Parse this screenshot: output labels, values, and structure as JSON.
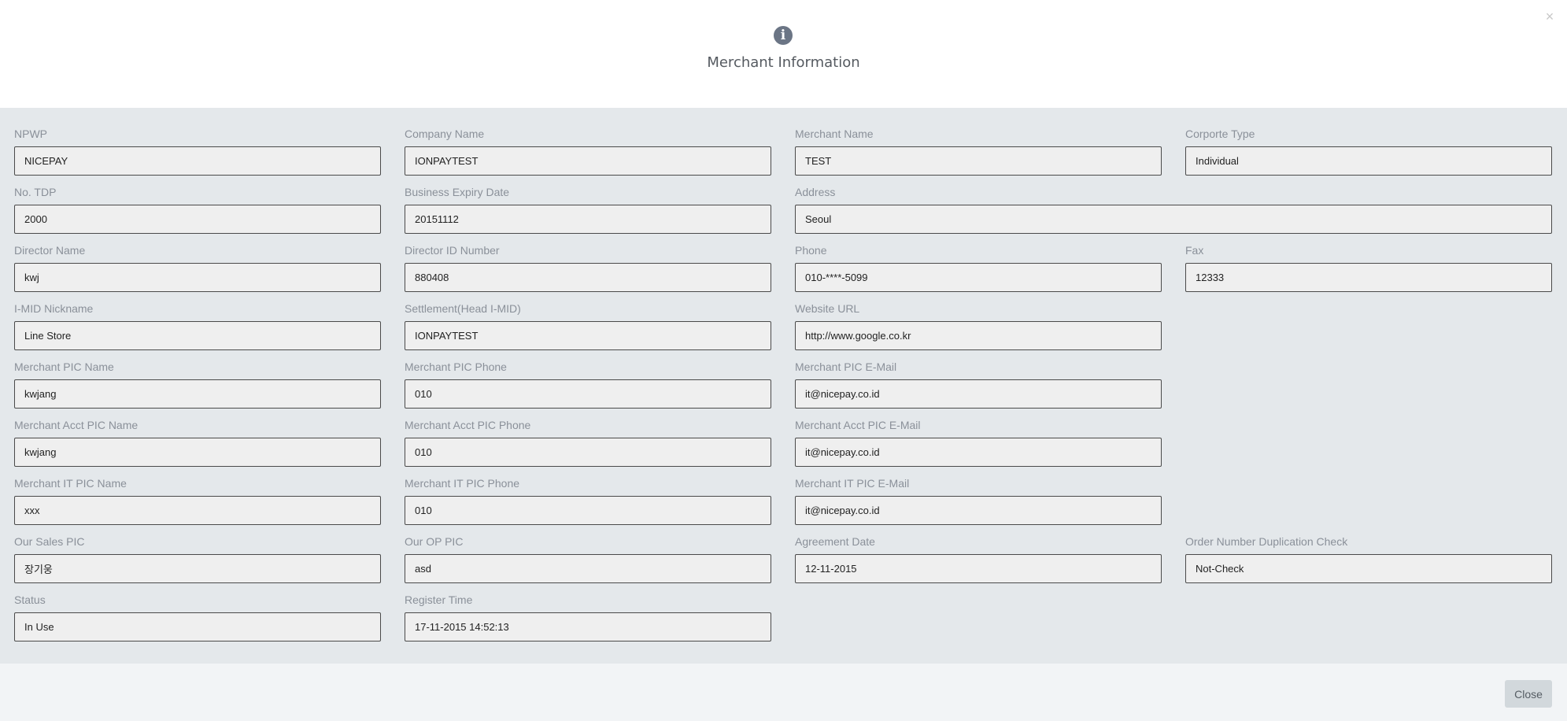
{
  "header": {
    "icon": "info-circle-icon",
    "title": "Merchant Information",
    "close_icon": "×"
  },
  "fields": {
    "npwp": {
      "label": "NPWP",
      "value": "NICEPAY"
    },
    "company_name": {
      "label": "Company Name",
      "value": "IONPAYTEST"
    },
    "merchant_name": {
      "label": "Merchant Name",
      "value": "TEST"
    },
    "corporate_type": {
      "label": "Corporte Type",
      "value": "Individual"
    },
    "no_tdp": {
      "label": "No. TDP",
      "value": "2000"
    },
    "business_expiry_date": {
      "label": "Business Expiry Date",
      "value": "20151112"
    },
    "address": {
      "label": "Address",
      "value": "Seoul"
    },
    "director_name": {
      "label": "Director Name",
      "value": "kwj"
    },
    "director_id_number": {
      "label": "Director ID Number",
      "value": "880408"
    },
    "phone": {
      "label": "Phone",
      "value": "010-****-5099"
    },
    "fax": {
      "label": "Fax",
      "value": "12333"
    },
    "imid_nickname": {
      "label": "I-MID Nickname",
      "value": "Line Store"
    },
    "settlement_head_imid": {
      "label": "Settlement(Head I-MID)",
      "value": "IONPAYTEST"
    },
    "website_url": {
      "label": "Website URL",
      "value": "http://www.google.co.kr"
    },
    "merchant_pic_name": {
      "label": "Merchant PIC Name",
      "value": "kwjang"
    },
    "merchant_pic_phone": {
      "label": "Merchant PIC Phone",
      "value": "010"
    },
    "merchant_pic_email": {
      "label": "Merchant PIC E-Mail",
      "value": "it@nicepay.co.id"
    },
    "merchant_acct_pic_name": {
      "label": "Merchant Acct PIC Name",
      "value": "kwjang"
    },
    "merchant_acct_pic_phone": {
      "label": "Merchant Acct PIC Phone",
      "value": "010"
    },
    "merchant_acct_pic_email": {
      "label": "Merchant Acct PIC E-Mail",
      "value": "it@nicepay.co.id"
    },
    "merchant_it_pic_name": {
      "label": "Merchant IT PIC Name",
      "value": "xxx"
    },
    "merchant_it_pic_phone": {
      "label": "Merchant IT PIC Phone",
      "value": "010"
    },
    "merchant_it_pic_email": {
      "label": "Merchant IT PIC E-Mail",
      "value": "it@nicepay.co.id"
    },
    "our_sales_pic": {
      "label": "Our Sales PIC",
      "value": "장기웅"
    },
    "our_op_pic": {
      "label": "Our OP PIC",
      "value": "asd"
    },
    "agreement_date": {
      "label": "Agreement Date",
      "value": "12-11-2015"
    },
    "order_number_duplication_check": {
      "label": "Order Number Duplication Check",
      "value": "Not-Check"
    },
    "status": {
      "label": "Status",
      "value": "In Use"
    },
    "register_time": {
      "label": "Register Time",
      "value": "17-11-2015 14:52:13"
    }
  },
  "footer": {
    "close_label": "Close"
  }
}
